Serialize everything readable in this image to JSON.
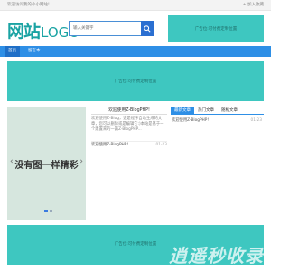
{
  "topbar": {
    "welcome": "欢迎访问我的小小网站!",
    "favorite": "+ 加入收藏"
  },
  "logo": {
    "cn": "网站",
    "en": "LOGO"
  },
  "search": {
    "placeholder": "输入关键字",
    "icon": "search-icon",
    "button_color": "#2b6fd1"
  },
  "header_ad": {
    "text": "广告位:可付费定制位置"
  },
  "nav": {
    "items": [
      {
        "label": "首页"
      },
      {
        "label": "留言本"
      }
    ]
  },
  "banner_ad": {
    "text": "广告位:可付费定制位置"
  },
  "slider": {
    "text": "没有图一样精彩",
    "arrow_left": "‹",
    "arrow_right": "›",
    "slide_count": 2,
    "active_slide": 1
  },
  "article": {
    "title": "欢迎使用Z-BlogPHP!",
    "excerpt": "欢迎使用Z-Blog，这是程序自动生成的文章，您可以删除或是编辑它:)本站是基于一个建置来的一篇Z-BlogPHP...",
    "more": "欢迎使用Z-BlogPHP!",
    "date": "01-23"
  },
  "tabs": {
    "items": [
      {
        "label": "最新文章",
        "active": true
      },
      {
        "label": "热门文章",
        "active": false
      },
      {
        "label": "随机文章",
        "active": false
      }
    ],
    "rows": [
      {
        "title": "欢迎使用Z-BlogPHP!",
        "date": "01-23"
      }
    ]
  },
  "footer_ad": {
    "text": "广告位:可付费定制位置",
    "watermark": "逍遥秒收录"
  },
  "colors": {
    "accent": "#2e8fe6",
    "ad_bg": "#3ec7c0",
    "logo": "#1aa3a3"
  }
}
